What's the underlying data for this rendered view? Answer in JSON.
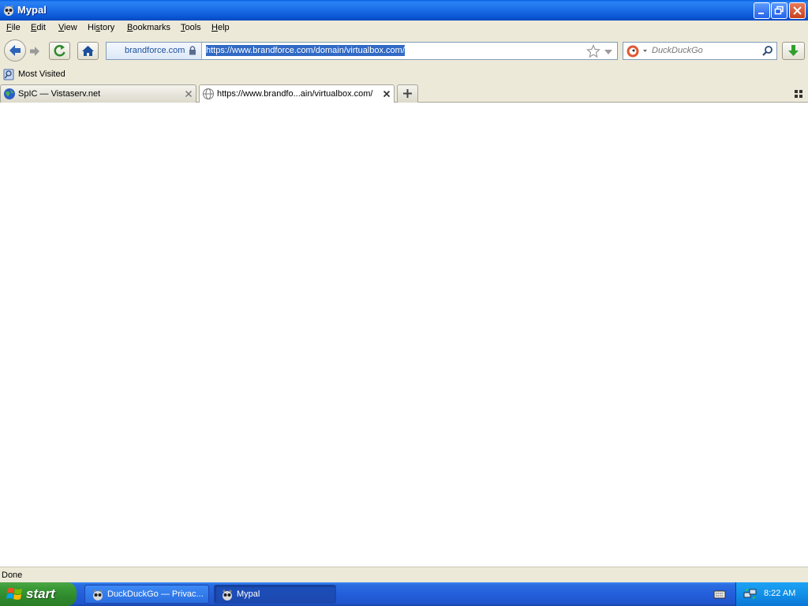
{
  "window": {
    "title": "Mypal",
    "minimize_label": "",
    "maximize_label": "",
    "close_label": ""
  },
  "menubar": {
    "items": [
      {
        "label": "File",
        "accel": "F"
      },
      {
        "label": "Edit",
        "accel": "E"
      },
      {
        "label": "View",
        "accel": "V"
      },
      {
        "label": "History",
        "accel": "s"
      },
      {
        "label": "Bookmarks",
        "accel": "B"
      },
      {
        "label": "Tools",
        "accel": "T"
      },
      {
        "label": "Help",
        "accel": "H"
      }
    ]
  },
  "navbar": {
    "identity_host": "brandforce.com",
    "url": "https://www.brandforce.com/domain/virtualbox.com/",
    "search_placeholder": "DuckDuckGo"
  },
  "bookmarks": {
    "items": [
      {
        "label": "Most Visited"
      }
    ]
  },
  "tabs": [
    {
      "label": "SpIC — Vistaserv.net",
      "active": false
    },
    {
      "label": "https://www.brandfo...ain/virtualbox.com/",
      "active": true
    }
  ],
  "statusbar": {
    "text": "Done"
  },
  "taskbar": {
    "start_label": "start",
    "tasks": [
      {
        "label": "DuckDuckGo — Privac..."
      },
      {
        "label": "Mypal"
      }
    ],
    "clock": "8:22 AM"
  },
  "colors": {
    "titlebar": "#0b58d6",
    "selection": "#316ac5",
    "taskbar": "#245edb",
    "start": "#3c9c38"
  }
}
